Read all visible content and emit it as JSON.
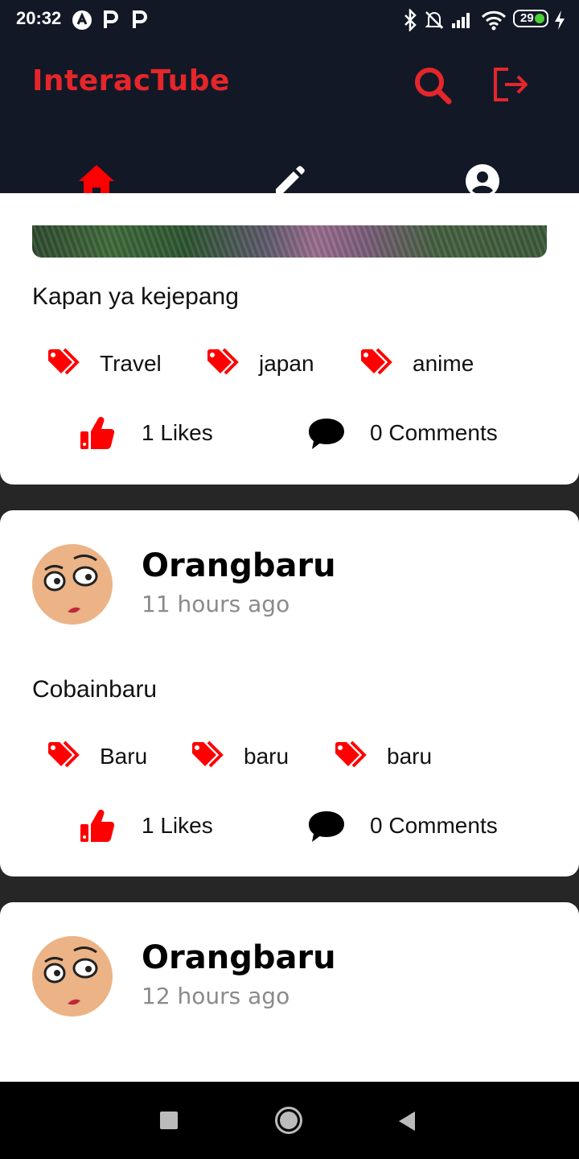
{
  "status_bar": {
    "time": "20:32",
    "battery": "29",
    "icons": [
      "a-icon",
      "p-icon",
      "p-icon",
      "bluetooth-icon",
      "mute-icon",
      "signal-icon",
      "wifi-icon",
      "charging-icon"
    ]
  },
  "app": {
    "title": "InteracTube",
    "accent": "#e5262a",
    "actions": [
      "search-icon",
      "logout-icon"
    ],
    "tabs": [
      "home-icon",
      "edit-icon",
      "account-icon"
    ],
    "active_tab": "home"
  },
  "posts": [
    {
      "text": "Kapan ya kejepang",
      "tags": [
        "Travel",
        "japan",
        "anime"
      ],
      "likes": "1 Likes",
      "comments": "0 Comments"
    },
    {
      "author": "Orangbaru",
      "time": "11 hours ago",
      "text": "Cobainbaru",
      "tags": [
        "Baru",
        "baru",
        "baru"
      ],
      "likes": "1 Likes",
      "comments": "0 Comments"
    },
    {
      "author": "Orangbaru",
      "time": "12 hours ago"
    }
  ],
  "nav": [
    "recents-icon",
    "home-icon",
    "back-icon"
  ]
}
